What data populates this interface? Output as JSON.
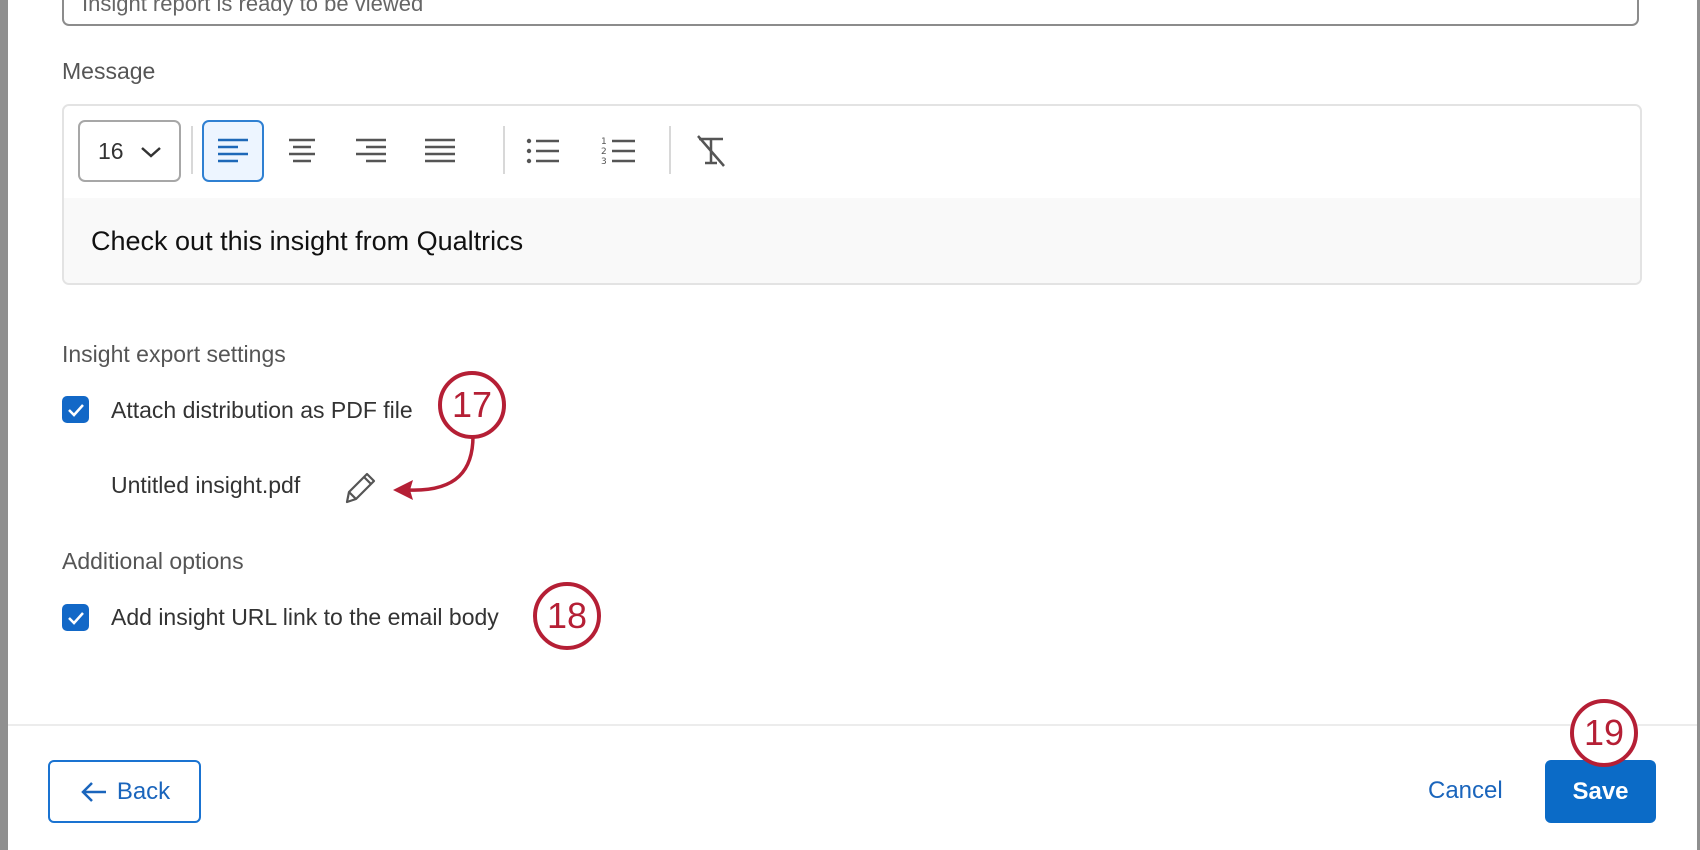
{
  "subject": {
    "value": "Insight report is ready to be viewed"
  },
  "message": {
    "label": "Message",
    "font_size": "16",
    "body_text": "Check out this insight from Qualtrics"
  },
  "toolbar": {
    "icons": [
      "align-left-icon",
      "align-center-icon",
      "align-right-icon",
      "justify-icon",
      "bullet-list-icon",
      "numbered-list-icon",
      "clear-format-icon"
    ]
  },
  "insight_export": {
    "label": "Insight export settings",
    "attach_pdf_label": "Attach distribution as PDF file",
    "attach_pdf_checked": true,
    "file_name": "Untitled insight.pdf"
  },
  "additional_options": {
    "label": "Additional options",
    "add_url_label": "Add insight URL link to the email body",
    "add_url_checked": true
  },
  "annotations": {
    "badge_17": "17",
    "badge_18": "18",
    "badge_19": "19"
  },
  "footer": {
    "back_label": "Back",
    "cancel_label": "Cancel",
    "save_label": "Save"
  },
  "colors": {
    "accent": "#0b6bc7",
    "annotation": "#b51f35"
  }
}
